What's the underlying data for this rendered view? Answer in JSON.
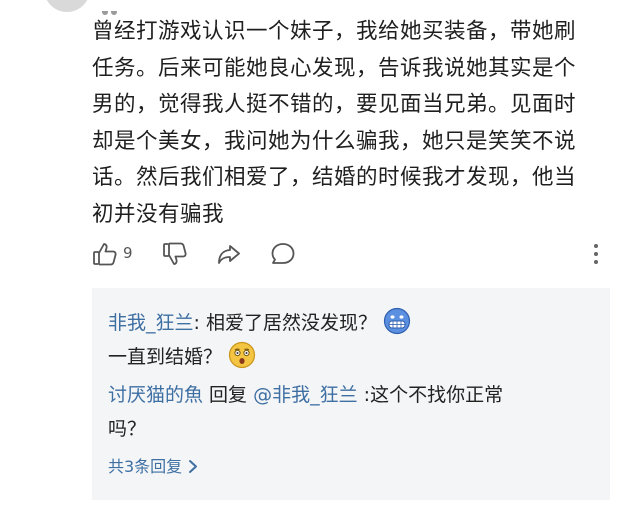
{
  "comment": {
    "lines": [
      "曾经打游戏认识一个妹子，我给她买装备，带她刷",
      "任务。后来可能她良心发现，告诉我说她其实是个",
      "男的，觉得我人挺不错的，要见面当兄弟。见面时",
      "却是个美女，我问她为什么骗我，她只是笑笑不说",
      "话。然后我们相爱了，结婚的时候我才发现，他当",
      "初并没有骗我"
    ],
    "like_count": "9",
    "icons": [
      "thumbs-up-icon",
      "thumbs-down-icon",
      "share-icon",
      "comment-icon",
      "more-vertical-icon"
    ]
  },
  "replies": {
    "reply1": {
      "user": "非我_狂兰",
      "text1": ": 相爱了居然没发现？",
      "text2": "一直到结婚？",
      "emoji1": "grimace-emoji",
      "emoji2": "astonished-emoji"
    },
    "reply2": {
      "user": "讨厌猫的魚",
      "reply_word": " 回复 ",
      "mention": "@非我_狂兰",
      "text1": " :这个不找你正常",
      "text2": "吗？"
    },
    "view_more": "共3条回复",
    "colors": {
      "username": "#3e6fa3",
      "box_bg": "#f4f5f7"
    }
  }
}
